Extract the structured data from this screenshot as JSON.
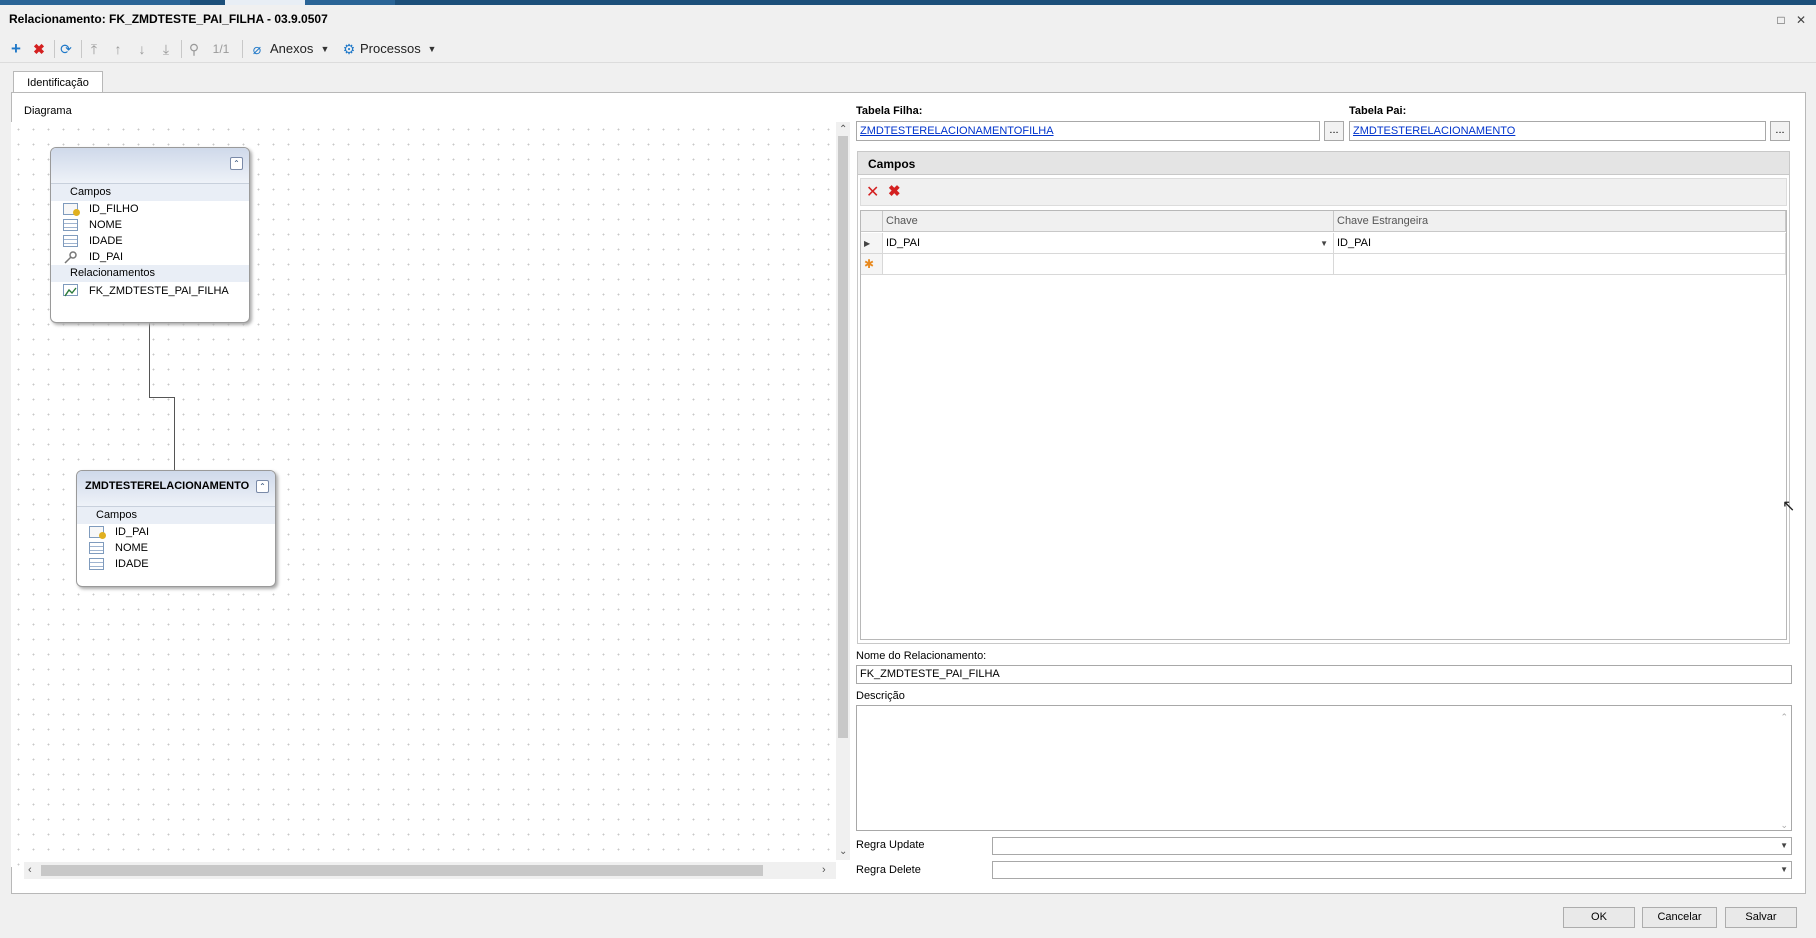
{
  "window": {
    "title": "Relacionamento: FK_ZMDTESTE_PAI_FILHA - 03.9.0507",
    "maximize_glyph": "□",
    "close_glyph": "✕"
  },
  "toolbar": {
    "record_counter": "1/1",
    "anexos_label": "Anexos",
    "processos_label": "Processos"
  },
  "tabs": [
    {
      "label": "Identificação"
    }
  ],
  "diagram": {
    "label": "Diagrama",
    "child_entity": {
      "title": "",
      "fields_section": "Campos",
      "fields": [
        "ID_FILHO",
        "NOME",
        "IDADE",
        "ID_PAI"
      ],
      "relations_section": "Relacionamentos",
      "relations": [
        "FK_ZMDTESTE_PAI_FILHA"
      ]
    },
    "parent_entity": {
      "title": "ZMDTESTERELACIONAMENTO",
      "fields_section": "Campos",
      "fields": [
        "ID_PAI",
        "NOME",
        "IDADE"
      ]
    }
  },
  "form": {
    "child_table_label": "Tabela Filha:",
    "child_table_value": "ZMDTESTERELACIONAMENTOFILHA",
    "parent_table_label": "Tabela Pai:",
    "parent_table_value": "ZMDTESTERELACIONAMENTO",
    "browse_button": "...",
    "campos_title": "Campos",
    "grid": {
      "columns": [
        "Chave",
        "Chave Estrangeira"
      ],
      "rows": [
        {
          "chave": "ID_PAI",
          "chave_estrangeira": "ID_PAI"
        }
      ]
    },
    "relationship_name_label": "Nome do Relacionamento:",
    "relationship_name_value": "FK_ZMDTESTE_PAI_FILHA",
    "description_label": "Descrição",
    "description_value": "",
    "update_rule_label": "Regra Update",
    "update_rule_value": "",
    "delete_rule_label": "Regra Delete",
    "delete_rule_value": ""
  },
  "footer": {
    "ok_label": "OK",
    "cancel_label": "Cancelar",
    "save_label": "Salvar"
  },
  "colors": {
    "accent_blue": "#1c4f7a",
    "link_blue": "#0033cc",
    "delete_red": "#d42020",
    "add_blue": "#1f78c8"
  }
}
